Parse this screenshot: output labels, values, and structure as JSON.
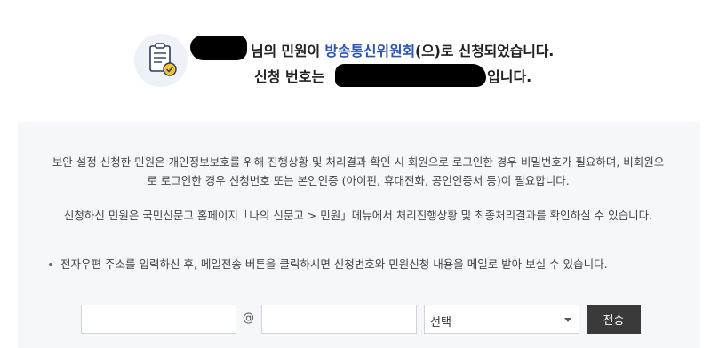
{
  "header": {
    "icon": "document-check-icon",
    "line1_suffix": "님의 민원이 ",
    "agency": "방송통신위원회",
    "line1_tail": "(으)로 신청되었습니다.",
    "line2_prefix": "신청 번호는",
    "line2_suffix": "입니다.",
    "agency_color": "#2b56b8"
  },
  "notices": {
    "security": "보안 설정 신청한 민원은 개인정보보호를 위해 진행상황 및 처리결과 확인 시 회원으로 로그인한 경우 비밀번호가 필요하며, 비회원으로 로그인한 경우 신청번호 또는 본인인증 (아이핀, 휴대전화, 공인인증서 등)이 필요합니다.",
    "check_status": "신청하신 민원은 국민신문고 홈페이지「나의 신문고 > 민원」메뉴에서 처리진행상황 및 최종처리결과를 확인하실 수 있습니다.",
    "email_tip": "전자우편 주소를 입력하신 후, 메일전송 버튼을 클릭하시면 신청번호와 민원신청 내용을 메일로 받아 보실 수 있습니다."
  },
  "email_form": {
    "local_value": "",
    "at_symbol": "@",
    "domain_value": "",
    "select_value": "선택",
    "send_label": "전송"
  },
  "colors": {
    "panel_bg": "#f6f7fb",
    "button_bg": "#3a3a3a"
  }
}
